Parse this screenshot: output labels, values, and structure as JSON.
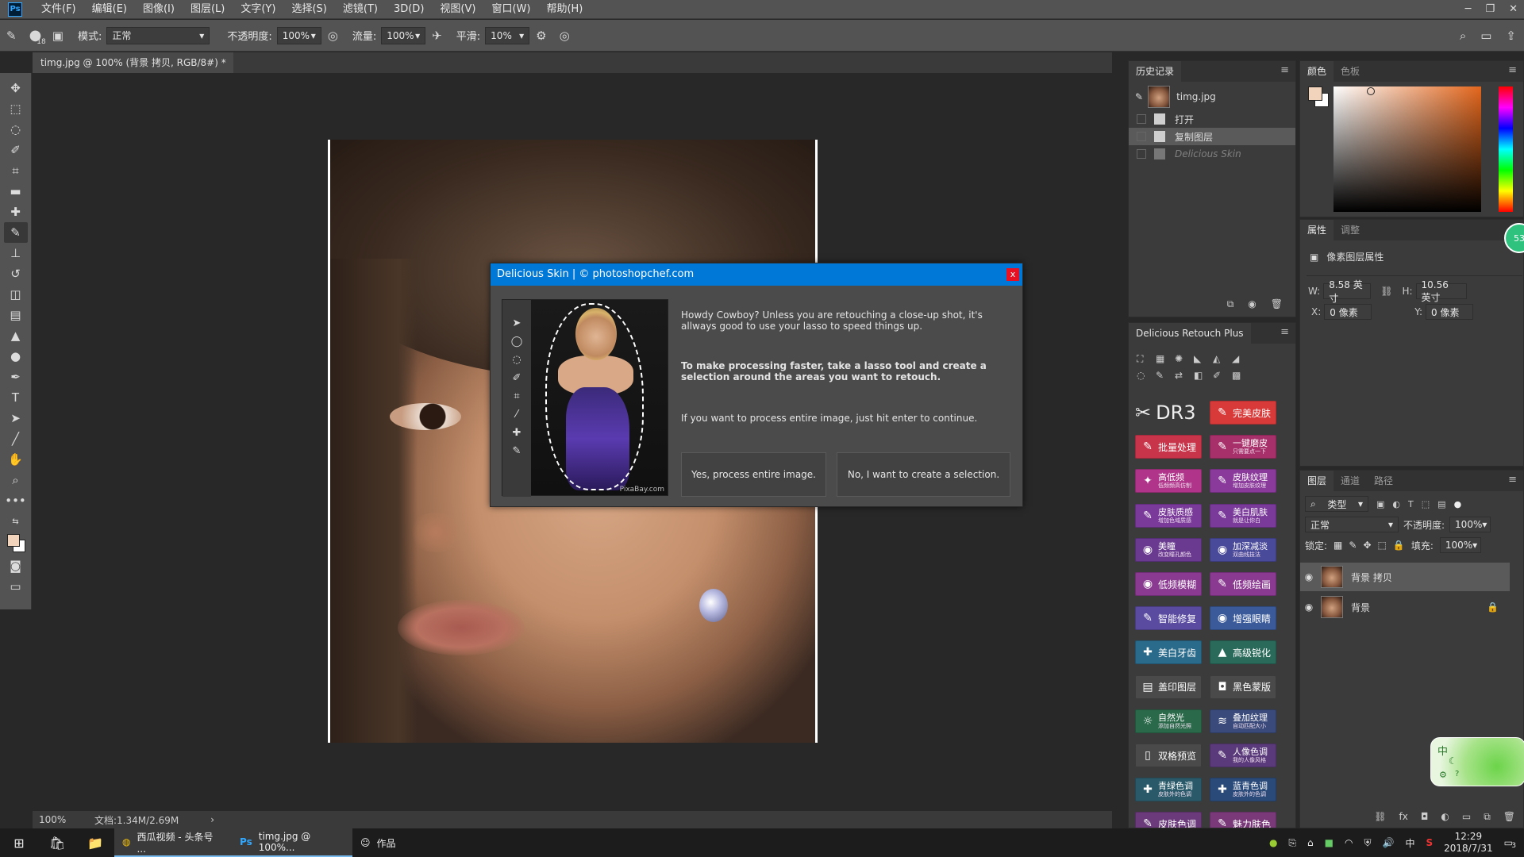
{
  "menubar": {
    "items": [
      "文件(F)",
      "编辑(E)",
      "图像(I)",
      "图层(L)",
      "文字(Y)",
      "选择(S)",
      "滤镜(T)",
      "3D(D)",
      "视图(V)",
      "窗口(W)",
      "帮助(H)"
    ]
  },
  "options": {
    "brush_size": "18",
    "mode_label": "模式:",
    "mode_value": "正常",
    "opacity_label": "不透明度:",
    "opacity_value": "100%",
    "flow_label": "流量:",
    "flow_value": "100%",
    "smooth_label": "平滑:",
    "smooth_value": "10%"
  },
  "doc_tab": {
    "title": "timg.jpg @ 100% (背景 拷贝, RGB/8#) *",
    "close": "×"
  },
  "status": {
    "zoom": "100%",
    "doc_size": "文档:1.34M/2.69M"
  },
  "dialog": {
    "title": "Delicious Skin | © photoshopchef.com",
    "close": "x",
    "credit": "PixaBay.com",
    "text1": "Howdy Cowboy? Unless you are retouching a close-up shot, it's allways good to use your lasso to speed things up.",
    "text2": "To make processing faster, take a lasso tool and create a selection around the areas you want to retouch.",
    "text3": "If you want to process entire image, just hit enter to continue.",
    "btn_yes": "Yes, process entire image.",
    "btn_no": "No, I want to create a selection."
  },
  "history": {
    "tab": "历史记录",
    "snapshot": "timg.jpg",
    "items": [
      "打开",
      "复制图层",
      "Delicious Skin"
    ]
  },
  "color_panel": {
    "tabs": [
      "颜色",
      "色板"
    ],
    "fg_color": "#f2d4bd",
    "bg_color": "#ffffff"
  },
  "props_panel": {
    "tabs": [
      "属性",
      "调整"
    ],
    "title": "像素图层属性",
    "w_label": "W:",
    "w_value": "8.58 英寸",
    "h_label": "H:",
    "h_value": "10.56 英寸",
    "x_label": "X:",
    "x_value": "0 像素",
    "y_label": "Y:",
    "y_value": "0 像素",
    "badge": "53"
  },
  "retouch_panel": {
    "title": "Delicious Retouch Plus",
    "logo": "DR3",
    "buttons": [
      {
        "label": "完美皮肤",
        "sub": "",
        "color": "#d83a3a"
      },
      {
        "label": "批量处理",
        "sub": "",
        "color": "#c8344a"
      },
      {
        "label": "一键磨皮",
        "sub": "只需要点一下",
        "color": "#a8306a"
      },
      {
        "label": "高低频",
        "sub": "低频频高仿制",
        "color": "#b0358a"
      },
      {
        "label": "皮肤纹理",
        "sub": "增加皮肤纹理",
        "color": "#8a3a9a"
      },
      {
        "label": "皮肤质感",
        "sub": "增加色域质感",
        "color": "#7a3a9a"
      },
      {
        "label": "美白肌肤",
        "sub": "就是让你白",
        "color": "#7a3a9a"
      },
      {
        "label": "美瞳",
        "sub": "改变瞳孔颜色",
        "color": "#6a3a90"
      },
      {
        "label": "加深减淡",
        "sub": "双曲线技法",
        "color": "#4a4a9a"
      },
      {
        "label": "低频模糊",
        "sub": "",
        "color": "#8a3a90"
      },
      {
        "label": "低频绘画",
        "sub": "",
        "color": "#8a3a90"
      },
      {
        "label": "智能修复",
        "sub": "",
        "color": "#5a4aa0"
      },
      {
        "label": "增强眼睛",
        "sub": "",
        "color": "#3a5a9a"
      },
      {
        "label": "美白牙齿",
        "sub": "",
        "color": "#2a6a8a"
      },
      {
        "label": "高级锐化",
        "sub": "",
        "color": "#2a6a5a"
      },
      {
        "label": "盖印图层",
        "sub": "",
        "color": "#4a4a4a"
      },
      {
        "label": "黑色蒙版",
        "sub": "",
        "color": "#4a4a4a"
      },
      {
        "label": "自然光",
        "sub": "添加自然光照",
        "color": "#2a6a4a"
      },
      {
        "label": "叠加纹理",
        "sub": "自动匹配大小",
        "color": "#3a4a7a"
      },
      {
        "label": "双格预览",
        "sub": "",
        "color": "#4a4a4a"
      },
      {
        "label": "人像色调",
        "sub": "我的人像风格",
        "color": "#5a3a7a"
      },
      {
        "label": "青绿色调",
        "sub": "皮肤外的色调",
        "color": "#2a5a6a"
      },
      {
        "label": "蓝青色调",
        "sub": "皮肤外的色调",
        "color": "#2a4a7a"
      },
      {
        "label": "皮肤色调",
        "sub": "",
        "color": "#6a3a7a"
      },
      {
        "label": "魅力肤色",
        "sub": "",
        "color": "#7a3a7a"
      }
    ]
  },
  "layers_panel": {
    "tabs": [
      "图层",
      "通道",
      "路径"
    ],
    "filter": "类型",
    "blend": "正常",
    "opacity_label": "不透明度:",
    "opacity_value": "100%",
    "lock_label": "锁定:",
    "fill_label": "填充:",
    "fill_value": "100%",
    "layers": [
      "背景 拷贝",
      "背景"
    ]
  },
  "ime": {
    "label": "中"
  },
  "taskbar": {
    "items": [
      "西瓜视频 - 头条号 ...",
      "timg.jpg @ 100%...",
      "作品"
    ],
    "time": "12:29",
    "date": "2018/7/31",
    "tray_lang": "中",
    "notify_count": "3"
  }
}
